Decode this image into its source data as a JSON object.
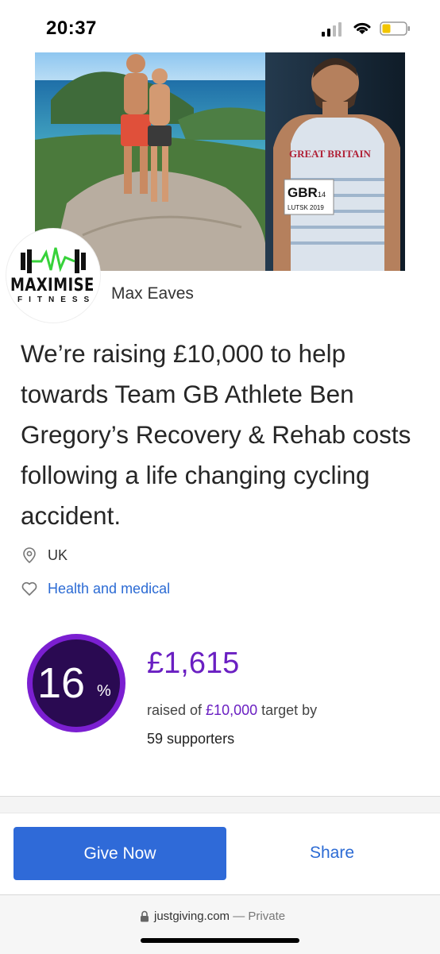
{
  "status": {
    "time": "20:37"
  },
  "page": {
    "owner_name": "Max Eaves",
    "logo": {
      "word": "MAXIMISE",
      "sub": "FITNESS"
    },
    "headline": "We’re raising £10,000 to help towards Team GB Athlete Ben Gregory’s Recovery & Rehab costs following a life changing cycling accident.",
    "location": "UK",
    "category": "Health and medical",
    "progress": {
      "percent": 16,
      "percent_sign": "%",
      "raised": "£1,615",
      "raised_prefix": "raised of ",
      "target": "£10,000",
      "target_suffix": " target by",
      "supporters": "59 supporters"
    },
    "hero_badge": {
      "text1": "GREAT BRITAIN",
      "text2": "GBR",
      "text3": "14",
      "text4": "LUTSK 2019"
    }
  },
  "actions": {
    "give_label": "Give Now",
    "share_label": "Share"
  },
  "browser": {
    "domain": "justgiving.com",
    "separator": " — ",
    "mode": "Private"
  },
  "colors": {
    "primary": "#2f6ad8",
    "purple": "#6a1fc2",
    "ring": "#7b1fd1"
  }
}
